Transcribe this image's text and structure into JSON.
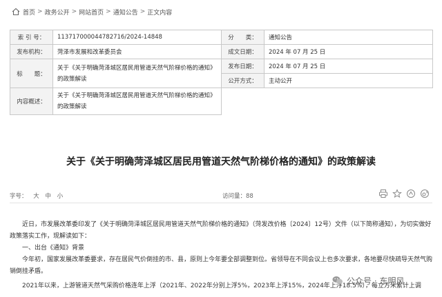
{
  "breadcrumb": [
    "首页",
    "政务公开",
    "网站首页",
    "通知公告",
    "正文内容"
  ],
  "meta": {
    "index_label": "索 引 号：",
    "index_value": "113717000044782716/2024-14848",
    "category_label": "分　　类：",
    "category_value": "通知公告",
    "org_label": "发布机构：",
    "org_value": "菏泽市发展和改革委员会",
    "created_label": "成文日期：",
    "created_value": "2024 年 07 月 25 日",
    "title_label": "标　　题：",
    "title_value_1": "关于《关于明确菏泽城区居民用管道天然气阶梯价格的通知》",
    "title_value_2": "的政策解读",
    "published_label": "发布日期：",
    "published_value": "2024 年 07 月 25 日",
    "disclosure_label": "公开方式：",
    "disclosure_value": "主动公开",
    "summary_label": "内容概述：",
    "summary_value_1": "关于《关于明确菏泽城区居民用管道天然气阶梯价格的通知》",
    "summary_value_2": "的政策解读"
  },
  "article": {
    "title": "关于《关于明确菏泽城区居民用管道天然气阶梯价格的通知》的政策解读",
    "font_label": "字号：",
    "font_large": "大",
    "font_medium": "中",
    "font_small": "小",
    "views": "访问量：88",
    "para1": "近日，市发展改革委印发了《关于明确菏泽城区居民用管道天然气阶梯价格的通知》（菏发改价格〔2024〕12号）文件（以下简称通知），为切实做好政策落实工作，现解读如下：",
    "heading1": "一、出台《通知》背景",
    "para2": "今年初，国家发展改革委要求，存在居民气价倒挂的市、县，原则上今年要全部调整到位。省领导在不同会议上也多次要求，各地要尽快疏导天然气购销倒挂矛盾。",
    "para3": "2021年以来，上游管道天然气采购价格连年上浮（2021年、2022年分别上浮5%，2023年上浮15%，2024年上浮18.5%），每立方米累计上调"
  },
  "watermark": "公众号 · 东明风"
}
